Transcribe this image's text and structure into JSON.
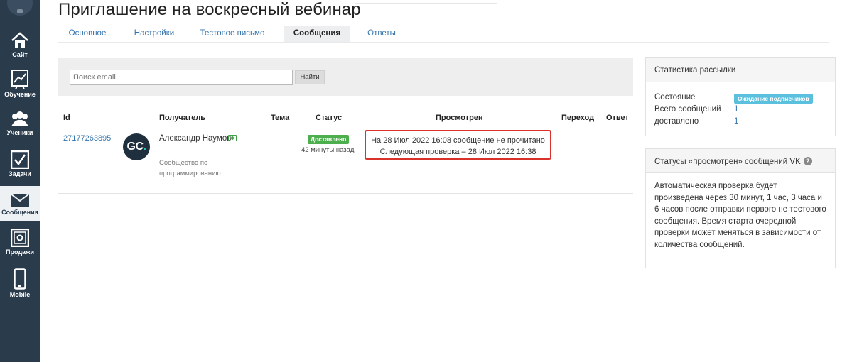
{
  "sidebar": {
    "items": [
      {
        "label": "Сайт",
        "icon": "home-icon"
      },
      {
        "label": "Обучение",
        "icon": "chart-board-icon"
      },
      {
        "label": "Ученики",
        "icon": "users-icon"
      },
      {
        "label": "Задачи",
        "icon": "checkbox-icon"
      },
      {
        "label": "Сообщения",
        "icon": "envelope-icon",
        "active": true
      },
      {
        "label": "Продажи",
        "icon": "safe-icon"
      },
      {
        "label": "Mobile",
        "icon": "phone-icon"
      }
    ]
  },
  "page": {
    "title": "Приглашение на воскресный вебинар"
  },
  "tabs": [
    {
      "label": "Основное"
    },
    {
      "label": "Настройки"
    },
    {
      "label": "Тестовое письмо"
    },
    {
      "label": "Сообщения",
      "active": true
    },
    {
      "label": "Ответы"
    }
  ],
  "search": {
    "placeholder": "Поиск email",
    "button_label": "Найти"
  },
  "table": {
    "columns": [
      "Id",
      "Получатель",
      "Тема",
      "Статус",
      "Просмотрен",
      "Переход",
      "Ответ"
    ],
    "rows": [
      {
        "id": "27177263895",
        "avatar_text": "GC",
        "avatar_dot": ".",
        "recipient": "Александр Наумов",
        "recipient_sub": "Сообщество по программированию",
        "status": "Доставлено",
        "status_time": "42 минуты назад",
        "viewed_line1": "На 28 Июл 2022 16:08 сообщение не прочитано",
        "viewed_line2": "Следующая проверка – 28 Июл 2022 16:38"
      }
    ]
  },
  "stats_panel": {
    "title": "Статистика рассылки",
    "state_label": "Состояние",
    "state_value": "Ожидание подписчиков",
    "total_label": "Всего сообщений",
    "total_value": "1",
    "delivered_label": "доставлено",
    "delivered_value": "1"
  },
  "vk_panel": {
    "title": "Статусы «просмотрен» сообщений VK",
    "help": "?",
    "body": "Автоматическая проверка будет произведена через 30 минут, 1 час, 3 часа и 6 часов после отправки первого не тестового сообщения. Время старта очередной проверки может меняться в зависимости от количества сообщений."
  },
  "colors": {
    "sidebar_bg": "#2a3b4c",
    "link": "#3473ad",
    "delivered_badge": "#4cae4c",
    "waiting_badge": "#5bc0de",
    "highlight_border": "#d9312b"
  }
}
